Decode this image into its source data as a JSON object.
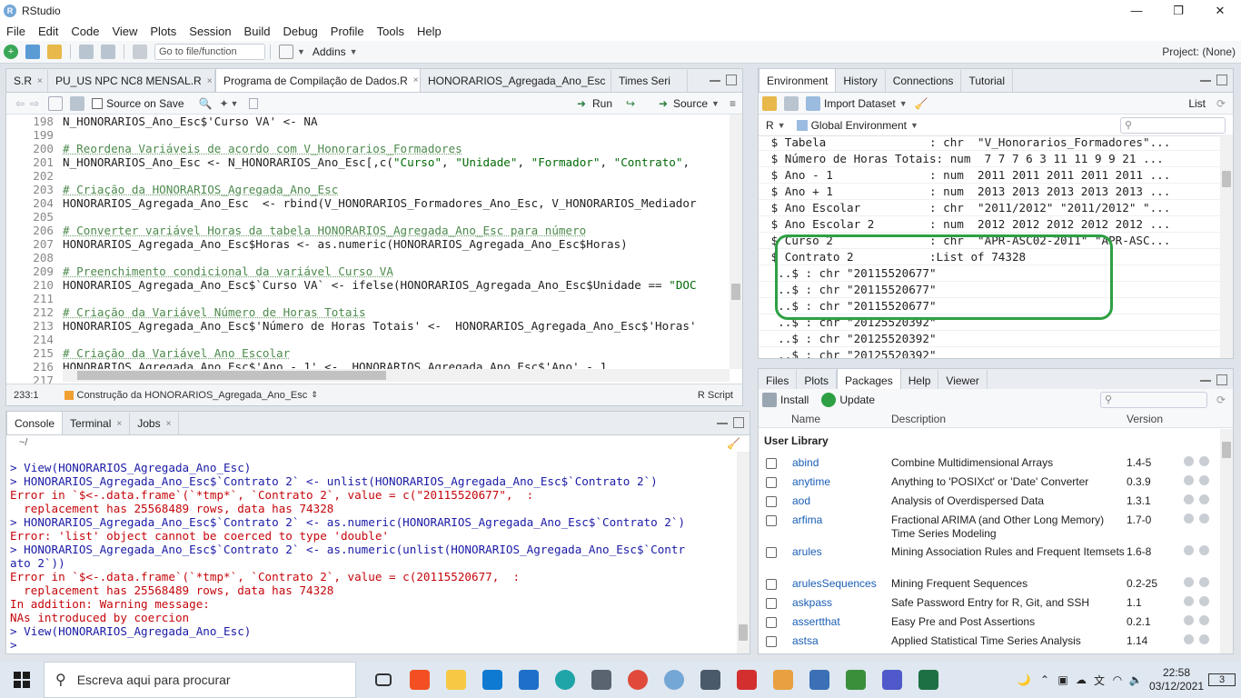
{
  "window": {
    "title": "RStudio",
    "minimize": "—",
    "restore": "❐",
    "close": "✕"
  },
  "menu": [
    "File",
    "Edit",
    "Code",
    "View",
    "Plots",
    "Session",
    "Build",
    "Debug",
    "Profile",
    "Tools",
    "Help"
  ],
  "toolbar": {
    "goto_placeholder": "Go to file/function",
    "addins": "Addins",
    "project": "Project: (None)"
  },
  "editor": {
    "tabs": [
      {
        "label": "S.R",
        "close": "×"
      },
      {
        "label": "PU_US NPC NC8 MENSAL.R",
        "close": "×"
      },
      {
        "label": "Programa de Compilação de Dados.R",
        "close": "×"
      },
      {
        "label": "HONORARIOS_Agregada_Ano_Esc",
        "close": "×"
      },
      {
        "label": "Times Seri",
        "close": ""
      }
    ],
    "source_on_save": "Source on Save",
    "run": "Run",
    "source": "Source",
    "lines": [
      {
        "n": "198",
        "parts": [
          {
            "t": "N_HONORARIOS_Ano_Esc$'Curso VA' <- NA",
            "c": ""
          }
        ]
      },
      {
        "n": "199",
        "parts": [
          {
            "t": "",
            "c": ""
          }
        ]
      },
      {
        "n": "200",
        "parts": [
          {
            "t": "# Reordena Variáveis de acordo com V_Honorarios_Formadores",
            "c": "cm"
          }
        ]
      },
      {
        "n": "201",
        "parts": [
          {
            "t": "N_HONORARIOS_Ano_Esc <- N_HONORARIOS_Ano_Esc[,c(",
            "c": ""
          },
          {
            "t": "\"Curso\"",
            "c": "str"
          },
          {
            "t": ", ",
            "c": ""
          },
          {
            "t": "\"Unidade\"",
            "c": "str"
          },
          {
            "t": ", ",
            "c": ""
          },
          {
            "t": "\"Formador\"",
            "c": "str"
          },
          {
            "t": ", ",
            "c": ""
          },
          {
            "t": "\"Contrato\"",
            "c": "str"
          },
          {
            "t": ",",
            "c": ""
          }
        ]
      },
      {
        "n": "202",
        "parts": [
          {
            "t": "",
            "c": ""
          }
        ]
      },
      {
        "n": "203",
        "parts": [
          {
            "t": "# Criação da HONORARIOS_Agregada_Ano_Esc",
            "c": "cm"
          }
        ]
      },
      {
        "n": "204",
        "parts": [
          {
            "t": "HONORARIOS_Agregada_Ano_Esc  <- rbind(V_HONORARIOS_Formadores_Ano_Esc, V_HONORARIOS_Mediador",
            "c": ""
          }
        ]
      },
      {
        "n": "205",
        "parts": [
          {
            "t": "",
            "c": ""
          }
        ]
      },
      {
        "n": "206",
        "parts": [
          {
            "t": "# Converter variável Horas da tabela HONORARIOS_Agregada_Ano_Esc para número",
            "c": "cm"
          }
        ]
      },
      {
        "n": "207",
        "parts": [
          {
            "t": "HONORARIOS_Agregada_Ano_Esc$Horas <- as.numeric(HONORARIOS_Agregada_Ano_Esc$Horas)",
            "c": ""
          }
        ]
      },
      {
        "n": "208",
        "parts": [
          {
            "t": "",
            "c": ""
          }
        ]
      },
      {
        "n": "209",
        "parts": [
          {
            "t": "# Preenchimento condicional da variável Curso VA",
            "c": "cm"
          }
        ]
      },
      {
        "n": "210",
        "parts": [
          {
            "t": "HONORARIOS_Agregada_Ano_Esc$`Curso VA` <- ifelse(HONORARIOS_Agregada_Ano_Esc$Unidade == ",
            "c": ""
          },
          {
            "t": "\"DOC",
            "c": "str"
          }
        ]
      },
      {
        "n": "211",
        "parts": [
          {
            "t": "",
            "c": ""
          }
        ]
      },
      {
        "n": "212",
        "parts": [
          {
            "t": "# Criação da Variável Número de Horas Totais",
            "c": "cm"
          }
        ]
      },
      {
        "n": "213",
        "parts": [
          {
            "t": "HONORARIOS_Agregada_Ano_Esc$'Número de Horas Totais' <-  HONORARIOS_Agregada_Ano_Esc$'Horas'",
            "c": ""
          }
        ]
      },
      {
        "n": "214",
        "parts": [
          {
            "t": "",
            "c": ""
          }
        ]
      },
      {
        "n": "215",
        "parts": [
          {
            "t": "# Criação da Variável Ano Escolar",
            "c": "cm"
          }
        ]
      },
      {
        "n": "216",
        "parts": [
          {
            "t": "HONORARIOS_Agregada_Ano_Esc$'Ano - 1' <-  HONORARIOS_Agregada_Ano_Esc$'Ano' - 1",
            "c": ""
          }
        ]
      },
      {
        "n": "217",
        "parts": [
          {
            "t": "",
            "c": ""
          }
        ]
      }
    ],
    "status_pos": "233:1",
    "status_scope": "Construção da HONORARIOS_Agregada_Ano_Esc",
    "status_lang": "R Script"
  },
  "console": {
    "tabs": [
      "Console",
      "Terminal",
      "Jobs"
    ],
    "path": "~/",
    "lines": [
      {
        "t": "> View(HONORARIOS_Agregada_Ano_Esc)",
        "c": "cmd"
      },
      {
        "t": "> HONORARIOS_Agregada_Ano_Esc$`Contrato 2` <- unlist(HONORARIOS_Agregada_Ano_Esc$`Contrato 2`)",
        "c": "cmd"
      },
      {
        "t": "Error in `$<-.data.frame`(`*tmp*`, `Contrato 2`, value = c(\"20115520677\",  :",
        "c": "err"
      },
      {
        "t": "  replacement has 25568489 rows, data has 74328",
        "c": "err"
      },
      {
        "t": "> HONORARIOS_Agregada_Ano_Esc$`Contrato 2` <- as.numeric(HONORARIOS_Agregada_Ano_Esc$`Contrato 2`)",
        "c": "cmd"
      },
      {
        "t": "Error: 'list' object cannot be coerced to type 'double'",
        "c": "err"
      },
      {
        "t": "> HONORARIOS_Agregada_Ano_Esc$`Contrato 2` <- as.numeric(unlist(HONORARIOS_Agregada_Ano_Esc$`Contr",
        "c": "cmd"
      },
      {
        "t": "ato 2`))",
        "c": "cmd"
      },
      {
        "t": "Error in `$<-.data.frame`(`*tmp*`, `Contrato 2`, value = c(20115520677,  :",
        "c": "err"
      },
      {
        "t": "  replacement has 25568489 rows, data has 74328",
        "c": "err"
      },
      {
        "t": "In addition: Warning message:",
        "c": "err"
      },
      {
        "t": "NAs introduced by coercion",
        "c": "err"
      },
      {
        "t": "> View(HONORARIOS_Agregada_Ano_Esc)",
        "c": "cmd"
      },
      {
        "t": "> ",
        "c": "cmd"
      }
    ]
  },
  "environment": {
    "tabs": [
      "Environment",
      "History",
      "Connections",
      "Tutorial"
    ],
    "import_dataset": "Import Dataset",
    "list_view": "List",
    "lang": "R",
    "scope": "Global Environment",
    "rows": [
      " $ Tabela               : chr  \"V_Honorarios_Formadores\"...",
      " $ Número de Horas Totais: num  7 7 7 6 3 11 11 9 9 21 ...",
      " $ Ano - 1              : num  2011 2011 2011 2011 2011 ...",
      " $ Ano + 1              : num  2013 2013 2013 2013 2013 ...",
      " $ Ano Escolar          : chr  \"2011/2012\" \"2011/2012\" \"...",
      " $ Ano Escolar 2        : num  2012 2012 2012 2012 2012 ...",
      " $ Curso 2              : chr  \"APR-ASC02-2011\" \"APR-ASC...",
      " $ Contrato 2           :List of 74328",
      "  ..$ : chr \"20115520677\"",
      "  ..$ : chr \"20115520677\"",
      "  ..$ : chr \"20115520677\"",
      "  ..$ : chr \"20125520392\"",
      "  ..$ : chr \"20125520392\"",
      "  ..$ : chr \"20125520392\""
    ]
  },
  "packages": {
    "tabs": [
      "Files",
      "Plots",
      "Packages",
      "Help",
      "Viewer"
    ],
    "install": "Install",
    "update": "Update",
    "col_name": "Name",
    "col_desc": "Description",
    "col_ver": "Version",
    "section": "User Library",
    "rows": [
      {
        "name": "abind",
        "desc": "Combine Multidimensional Arrays",
        "ver": "1.4-5"
      },
      {
        "name": "anytime",
        "desc": "Anything to 'POSIXct' or 'Date' Converter",
        "ver": "0.3.9"
      },
      {
        "name": "aod",
        "desc": "Analysis of Overdispersed Data",
        "ver": "1.3.1"
      },
      {
        "name": "arfima",
        "desc": "Fractional ARIMA (and Other Long Memory) Time Series Modeling",
        "ver": "1.7-0"
      },
      {
        "name": "arules",
        "desc": "Mining Association Rules and Frequent Itemsets",
        "ver": "1.6-8"
      },
      {
        "name": "arulesSequences",
        "desc": "Mining Frequent Sequences",
        "ver": "0.2-25"
      },
      {
        "name": "askpass",
        "desc": "Safe Password Entry for R, Git, and SSH",
        "ver": "1.1"
      },
      {
        "name": "assertthat",
        "desc": "Easy Pre and Post Assertions",
        "ver": "0.2.1"
      },
      {
        "name": "astsa",
        "desc": "Applied Statistical Time Series Analysis",
        "ver": "1.14"
      }
    ]
  },
  "taskbar": {
    "search_placeholder": "Escreva aqui para procurar",
    "time": "22:58",
    "date": "03/12/2021",
    "notifications": "3"
  }
}
